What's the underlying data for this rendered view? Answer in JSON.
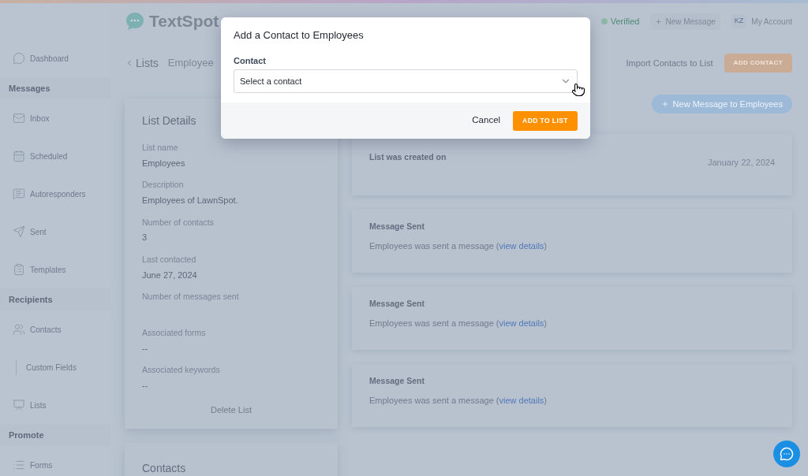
{
  "header": {
    "logo": "TextSpot",
    "status": "Verified",
    "new_message": "New Message",
    "avatar": "KZ",
    "account": "My Account"
  },
  "sidebar": [
    {
      "kind": "item",
      "label": "Dashboard"
    },
    {
      "kind": "header",
      "label": "Messages"
    },
    {
      "kind": "item",
      "label": "Inbox"
    },
    {
      "kind": "item",
      "label": "Scheduled"
    },
    {
      "kind": "item",
      "label": "Autoresponders"
    },
    {
      "kind": "item",
      "label": "Sent"
    },
    {
      "kind": "item",
      "label": "Templates"
    },
    {
      "kind": "header",
      "label": "Recipients"
    },
    {
      "kind": "item",
      "label": "Contacts"
    },
    {
      "kind": "subitem",
      "label": "Custom Fields"
    },
    {
      "kind": "item",
      "label": "Lists"
    },
    {
      "kind": "header",
      "label": "Promote"
    },
    {
      "kind": "item",
      "label": "Forms"
    }
  ],
  "breadcrumb": {
    "back": "Lists",
    "current": "Employee"
  },
  "actions": {
    "import": "Import Contacts to List",
    "add_contact": "ADD CONTACT",
    "new_message": "New Message to Employees"
  },
  "list_details": {
    "title": "List Details",
    "fields": [
      {
        "label": "List name",
        "value": "Employees"
      },
      {
        "label": "Description",
        "value": "Employees of LawnSpot."
      },
      {
        "label": "Number of contacts",
        "value": "3"
      },
      {
        "label": "Last contacted",
        "value": "June 27, 2024"
      },
      {
        "label": "Number of messages sent"
      },
      {
        "label": "Associated forms",
        "value": "--"
      },
      {
        "label": "Associated keywords",
        "value": "--"
      }
    ],
    "delete": "Delete List"
  },
  "activity": [
    {
      "kind": "created",
      "title": "List was created on",
      "date": "January 22, 2024"
    },
    {
      "kind": "message",
      "title": "Message Sent",
      "text": "Employees was sent a message (",
      "link": "view details",
      "close": ")"
    },
    {
      "kind": "message",
      "title": "Message Sent",
      "text": "Employees was sent a message (",
      "link": "view details",
      "close": ")"
    },
    {
      "kind": "message",
      "title": "Message Sent",
      "text": "Employees was sent a message (",
      "link": "view details",
      "close": ")"
    }
  ],
  "contacts_title": "Contacts",
  "dialog": {
    "title": "Add a Contact to Employees",
    "field_label": "Contact",
    "placeholder": "Select a contact",
    "cancel": "Cancel",
    "submit": "ADD TO LIST"
  }
}
